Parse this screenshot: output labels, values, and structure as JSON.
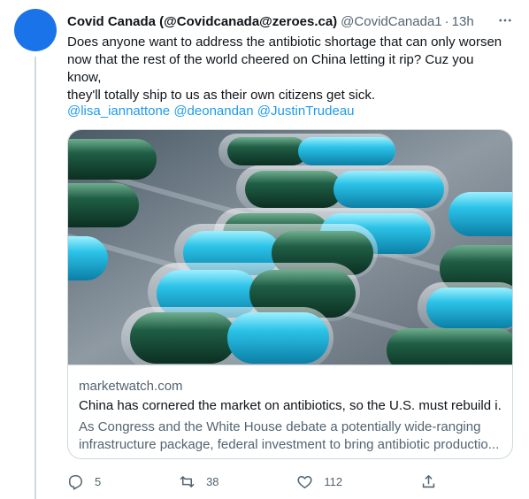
{
  "tweet": {
    "display_name": "Covid Canada (@Covidcanada@zeroes.ca)",
    "handle": "@CovidCanada1",
    "separator": "·",
    "timestamp": "13h",
    "text_line1": "Does anyone want to address the antibiotic shortage that can only worsen",
    "text_line2": "now that the rest of the world cheered on China letting it rip? Cuz you know,",
    "text_line3": "they'll totally ship to us as their own citizens get sick.",
    "mentions": [
      "@lisa_iannattone",
      "@deonandan",
      "@JustinTrudeau"
    ]
  },
  "card": {
    "domain": "marketwatch.com",
    "title": "China has cornered the market on antibiotics, so the U.S. must rebuild i...",
    "description_line1": "As Congress and the White House debate a potentially wide-ranging",
    "description_line2": "infrastructure package, federal investment to bring antibiotic productio...",
    "image_subject": "blue-and-green-capsules-in-blister-pack"
  },
  "actions": {
    "reply_count": "5",
    "retweet_count": "38",
    "like_count": "112"
  },
  "colors": {
    "avatar": "#1a73e8",
    "link": "#1d9bf0",
    "secondary_text": "#536471",
    "border": "#cfd9de"
  }
}
